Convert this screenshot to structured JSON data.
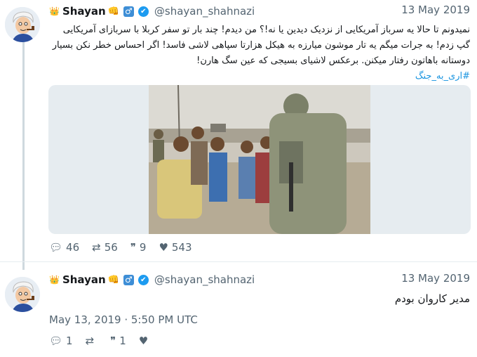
{
  "tweet1": {
    "crown": "👑",
    "name": "Shayan",
    "name_emoji": "👊",
    "male_symbol": "♂",
    "verified_symbol": "✔",
    "handle": "@shayan_shahnazi",
    "date": "13 May 2019",
    "lines": [
      "نمیدونم تا حالا یه سرباز آمریکایی از نزدیک دیدین یا نه!؟ من دیدم! چند بار تو سفر کربلا با سربازای آمریکایی",
      "گپ زدم! به جرات میگم یه تار موشون میارزه به هیکل هزارتا سپاهی لاشی فاسد! اگر احساس خطر نکن بسیار",
      "دوستانه باهاتون رفتار میکنن. برعکس لاشیای بسیجی که عین سگ هارن!"
    ],
    "hashtag": "#ارى_به_جنگ",
    "image_alt": "Soldier talking with children",
    "stats": {
      "replies": "46",
      "retweets": "56",
      "quotes": "9",
      "likes": "543"
    }
  },
  "tweet2": {
    "crown": "👑",
    "name": "Shayan",
    "name_emoji": "👊",
    "male_symbol": "♂",
    "verified_symbol": "✔",
    "handle": "@shayan_shahnazi",
    "date": "13 May 2019",
    "text": "مدیر کاروان بودم",
    "timestamp": "May 13, 2019 · 5:50 PM UTC",
    "stats": {
      "replies": "1",
      "retweets": "",
      "quotes": "1",
      "likes": ""
    }
  },
  "icons": {
    "reply": "comment-icon",
    "retweet": "retweet-icon",
    "quote": "quote-icon",
    "like": "heart-icon"
  },
  "colors": {
    "link": "#1b95e0",
    "thread_line": "#cfd9de",
    "meta": "#536471"
  }
}
